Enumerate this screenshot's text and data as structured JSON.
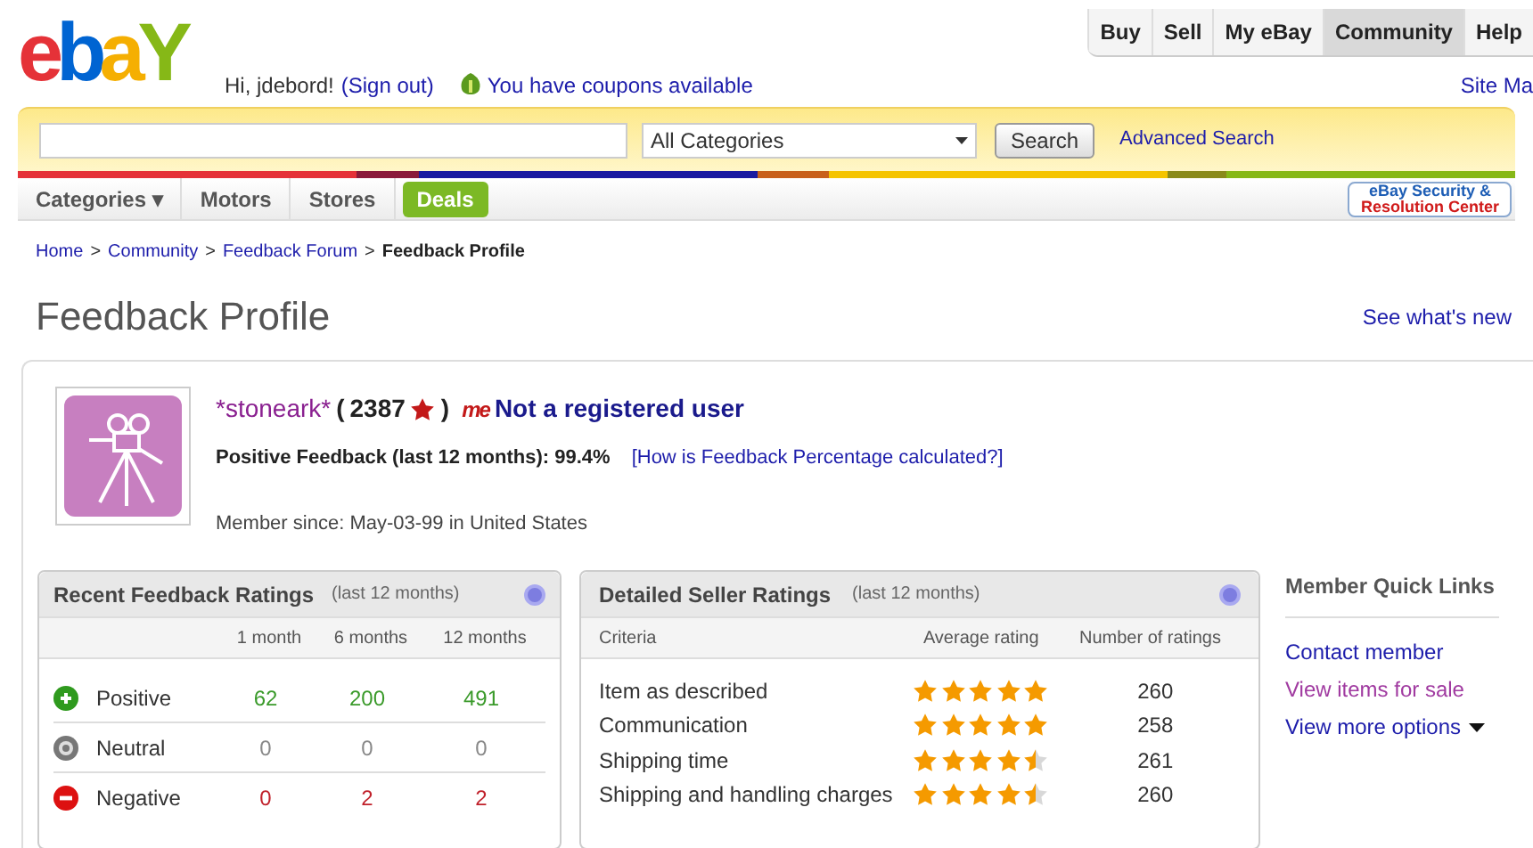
{
  "logo": "ebaY",
  "greeting": {
    "text": "Hi, jdebord!",
    "sign_out": "(Sign out)",
    "coupons": "You have coupons available"
  },
  "top_nav": [
    {
      "label": "Buy",
      "selected": false
    },
    {
      "label": "Sell",
      "selected": false
    },
    {
      "label": "My eBay",
      "selected": false
    },
    {
      "label": "Community",
      "selected": true
    },
    {
      "label": "Help",
      "selected": false
    }
  ],
  "site_map": "Site Ma",
  "search": {
    "category": "All Categories",
    "button": "Search",
    "advanced": "Advanced Search"
  },
  "category_nav": [
    {
      "label": "Categories ▾",
      "kind": "tab"
    },
    {
      "label": "Motors",
      "kind": "tab"
    },
    {
      "label": "Stores",
      "kind": "tab"
    },
    {
      "label": "Deals",
      "kind": "highlight"
    }
  ],
  "security_badge": {
    "line_1": "eBay Security &",
    "line_2": "Resolution Center"
  },
  "breadcrumb": [
    {
      "label": "Home",
      "current": false
    },
    {
      "label": "Community",
      "current": false
    },
    {
      "label": "Feedback Forum",
      "current": false
    },
    {
      "label": "Feedback Profile",
      "current": true
    }
  ],
  "breadcrumb_separator": ">",
  "page_title": "Feedback Profile",
  "see_whats_new": "See what's new",
  "profile": {
    "username": "*stoneark*",
    "open_paren": "(",
    "score": "2387",
    "close_paren": ")",
    "me_badge": "me",
    "registration": "Not a registered user",
    "positive_feedback": "Positive Feedback (last 12 months): 99.4%",
    "percentage_help": "[How is Feedback Percentage calculated?]",
    "member_since": "Member since: May-03-99 in United States"
  },
  "recent_ratings": {
    "title": "Recent Feedback Ratings",
    "subtitle": "(last 12 months)",
    "columns": [
      "1 month",
      "6 months",
      "12 months"
    ],
    "rows": [
      {
        "label": "Positive",
        "kind": "positive",
        "values": [
          "62",
          "200",
          "491"
        ]
      },
      {
        "label": "Neutral",
        "kind": "neutral",
        "values": [
          "0",
          "0",
          "0"
        ]
      },
      {
        "label": "Negative",
        "kind": "negative",
        "values": [
          "0",
          "2",
          "2"
        ]
      }
    ]
  },
  "seller_ratings": {
    "title": "Detailed Seller Ratings",
    "subtitle": "(last 12 months)",
    "columns": [
      "Criteria",
      "Average rating",
      "Number of ratings"
    ],
    "rows": [
      {
        "criteria": "Item as described",
        "stars": 5,
        "count": "260"
      },
      {
        "criteria": "Communication",
        "stars": 5,
        "count": "258"
      },
      {
        "criteria": "Shipping time",
        "stars": 4.5,
        "count": "261"
      },
      {
        "criteria": "Shipping and handling charges",
        "stars": 4.5,
        "count": "260"
      }
    ]
  },
  "quick_links": {
    "title": "Member Quick Links",
    "links": [
      {
        "label": "Contact member",
        "visited": false,
        "menu": false
      },
      {
        "label": "View items for sale",
        "visited": true,
        "menu": false
      },
      {
        "label": "View more options",
        "visited": false,
        "menu": true
      }
    ]
  }
}
